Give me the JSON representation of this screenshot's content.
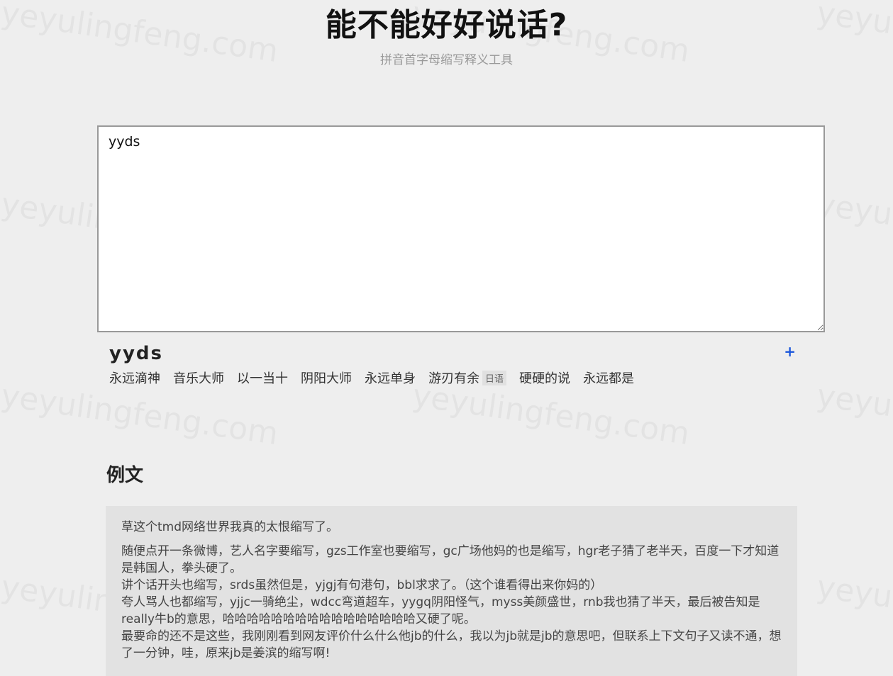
{
  "header": {
    "title": "能不能好好说话?",
    "subtitle": "拼音首字母缩写释义工具"
  },
  "input": {
    "value": "yyds"
  },
  "result": {
    "word": "yyds",
    "add_label": "+",
    "meanings": [
      {
        "text": "永远滴神",
        "tag": ""
      },
      {
        "text": "音乐大师",
        "tag": ""
      },
      {
        "text": "以一当十",
        "tag": ""
      },
      {
        "text": "阴阳大师",
        "tag": ""
      },
      {
        "text": "永远单身",
        "tag": ""
      },
      {
        "text": "游刃有余",
        "tag": "日语"
      },
      {
        "text": "硬硬的说",
        "tag": ""
      },
      {
        "text": "永远都是",
        "tag": ""
      }
    ]
  },
  "example": {
    "heading": "例文",
    "paragraph1": "草这个tmd网络世界我真的太恨缩写了。",
    "lines": [
      "随便点开一条微博，艺人名字要缩写，gzs工作室也要缩写，gc广场他妈的也是缩写，hgr老子猜了老半天，百度一下才知道是韩国人，拳头硬了。",
      "讲个话开头也缩写，srds虽然但是，yjgj有句港句，bbl求求了。（这个谁看得出来你妈的）",
      "夸人骂人也都缩写，yjjc一骑绝尘，wdcc弯道超车，yygq阴阳怪气，myss美颜盛世，rnb我也猜了半天，最后被告知是really牛b的意思，哈哈哈哈哈哈哈哈哈哈哈哈哈哈哈哈又硬了呢。",
      "最要命的还不是这些，我刚刚看到网友评价什么什么他jb的什么，我以为jb就是jb的意思吧，但联系上下文句子又读不通，想了一分钟，哇，原来jb是姜滨的缩写啊!"
    ]
  },
  "watermark": {
    "text": "yeyulingfeng.com"
  }
}
